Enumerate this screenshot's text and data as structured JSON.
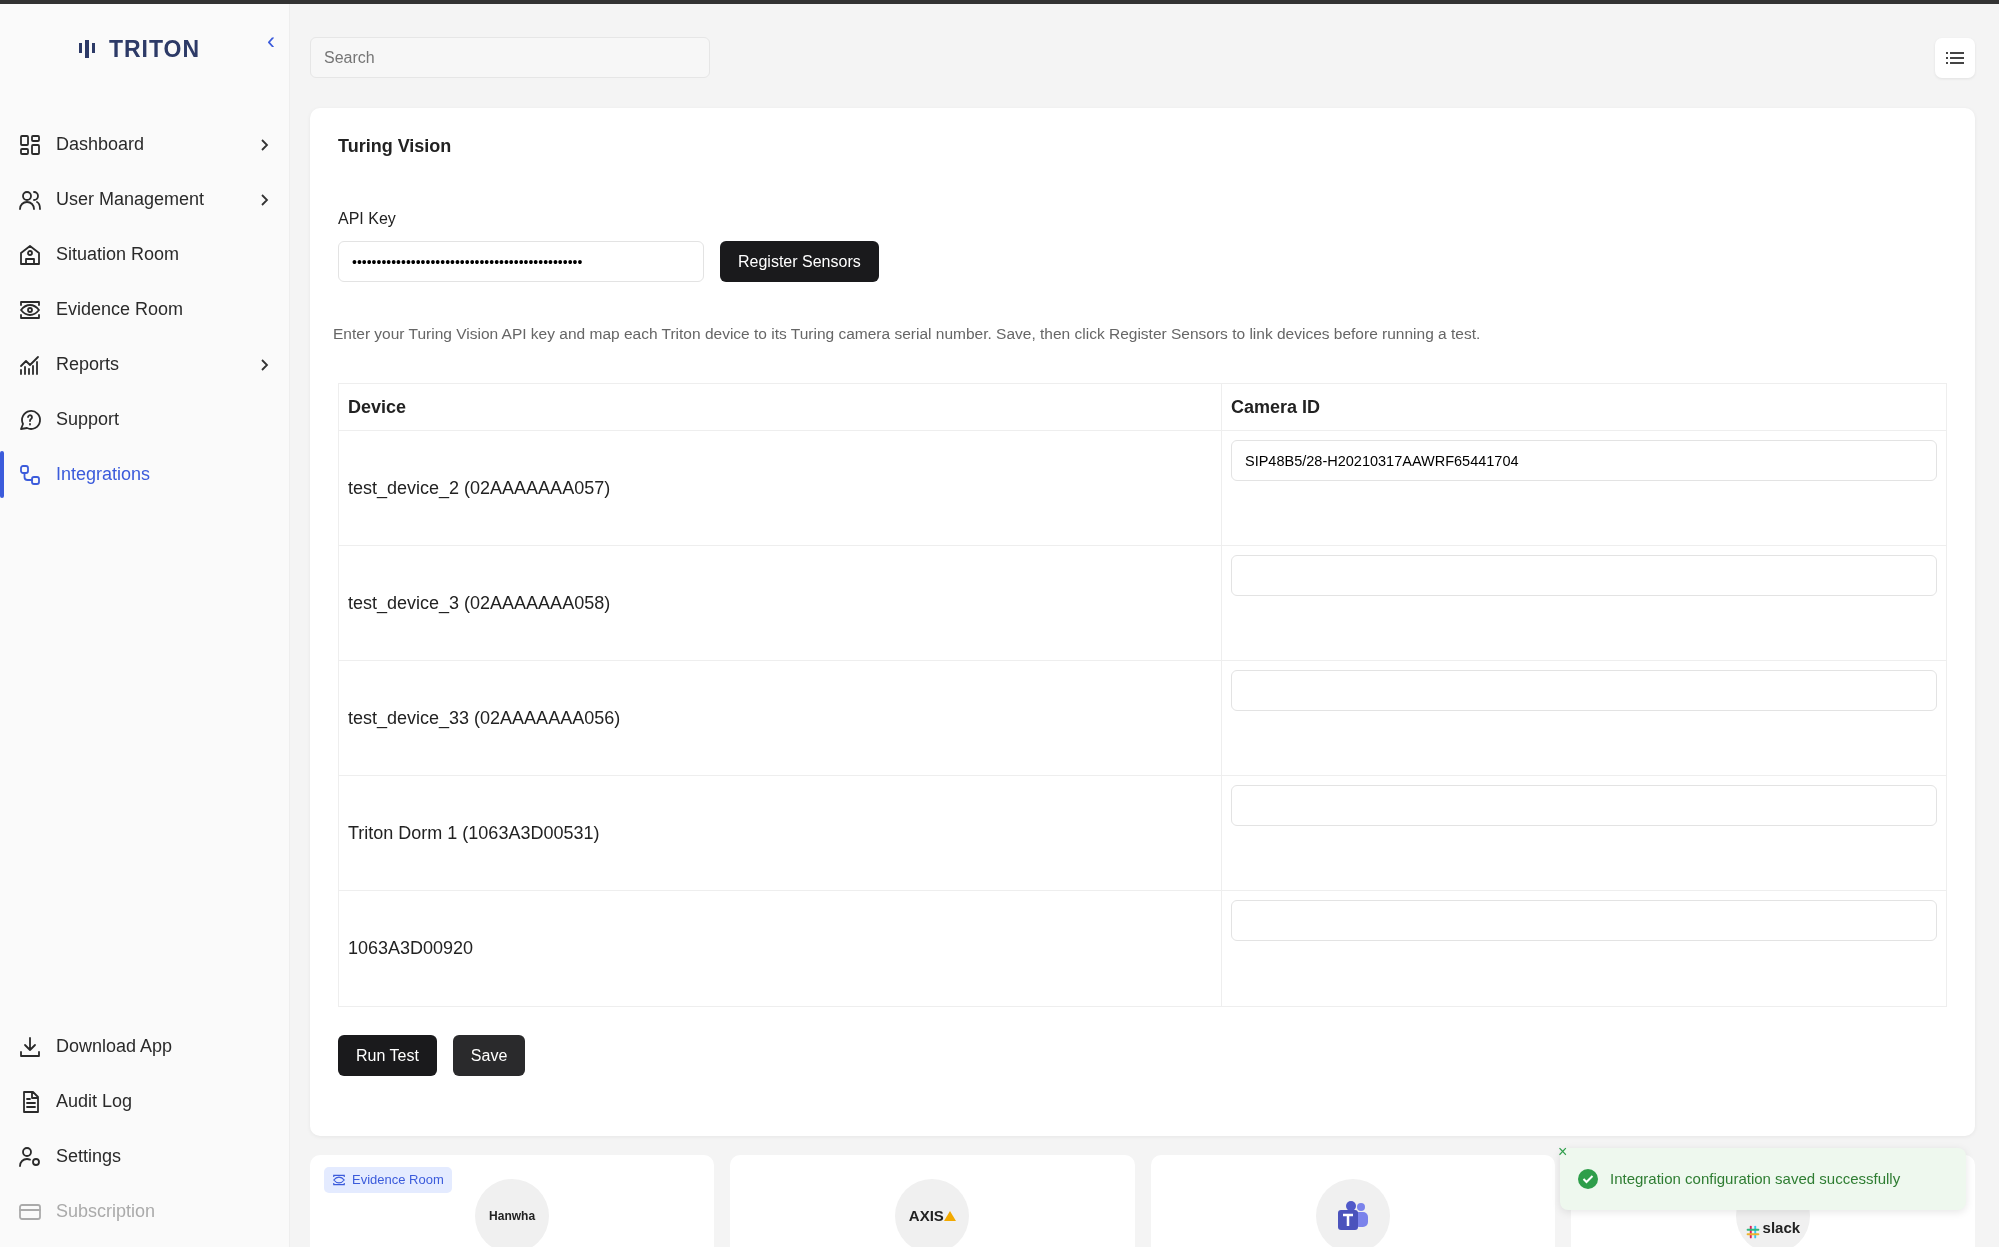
{
  "sidebar": {
    "logo": "TRITON",
    "collapse": "‹",
    "items": [
      {
        "label": "Dashboard",
        "kind": "grid",
        "chevron": true,
        "selected": false,
        "disabled": false
      },
      {
        "label": "User Management",
        "kind": "users",
        "chevron": true,
        "selected": false,
        "disabled": false
      },
      {
        "label": "Situation Room",
        "kind": "building",
        "chevron": false,
        "selected": false,
        "disabled": false
      },
      {
        "label": "Evidence Room",
        "kind": "eye",
        "chevron": false,
        "selected": false,
        "disabled": false
      },
      {
        "label": "Reports",
        "kind": "chart",
        "chevron": true,
        "selected": false,
        "disabled": false
      },
      {
        "label": "Support",
        "kind": "help",
        "chevron": false,
        "selected": false,
        "disabled": false
      },
      {
        "label": "Integrations",
        "kind": "link",
        "chevron": false,
        "selected": true,
        "disabled": false
      }
    ],
    "bottom_items": [
      {
        "label": "Download App",
        "kind": "download",
        "disabled": false
      },
      {
        "label": "Audit Log",
        "kind": "doc",
        "disabled": false
      },
      {
        "label": "Settings",
        "kind": "usergear",
        "disabled": false
      },
      {
        "label": "Subscription",
        "kind": "card",
        "disabled": true
      }
    ]
  },
  "search": {
    "placeholder": "Search"
  },
  "panel": {
    "title": "Turing Vision",
    "api_key_label": "API Key",
    "api_key_value": "•••••••••••••••••••••••••••••••••••••••••••••••",
    "register_button": "Register Sensors",
    "help": "Enter your Turing Vision API key and map each Triton device to its Turing camera serial number. Save, then click Register Sensors to link devices before running a test.",
    "table": {
      "columns": [
        "Device",
        "Camera ID"
      ],
      "rows": [
        {
          "device": "test_device_2 (02AAAAAAA057)",
          "camera_id": "SIP48B5/28-H20210317AAWRF65441704"
        },
        {
          "device": "test_device_3 (02AAAAAAA058)"
        },
        {
          "device": "test_device_33 (02AAAAAAA056)"
        },
        {
          "device": "Triton Dorm 1 (1063A3D00531)"
        },
        {
          "device": "1063A3D00920"
        }
      ]
    },
    "buttons": [
      "Run Test",
      "Save"
    ]
  },
  "integration_cards": [
    {
      "badge": "Evidence Room",
      "logo": "Hanwha",
      "kind": "hanwha"
    },
    {
      "logo": "AXIS",
      "kind": "axis"
    },
    {
      "kind": "teams"
    },
    {
      "logo": "slack",
      "kind": "slack"
    }
  ],
  "toast": {
    "message": "Integration configuration saved successfully",
    "close": "×"
  }
}
